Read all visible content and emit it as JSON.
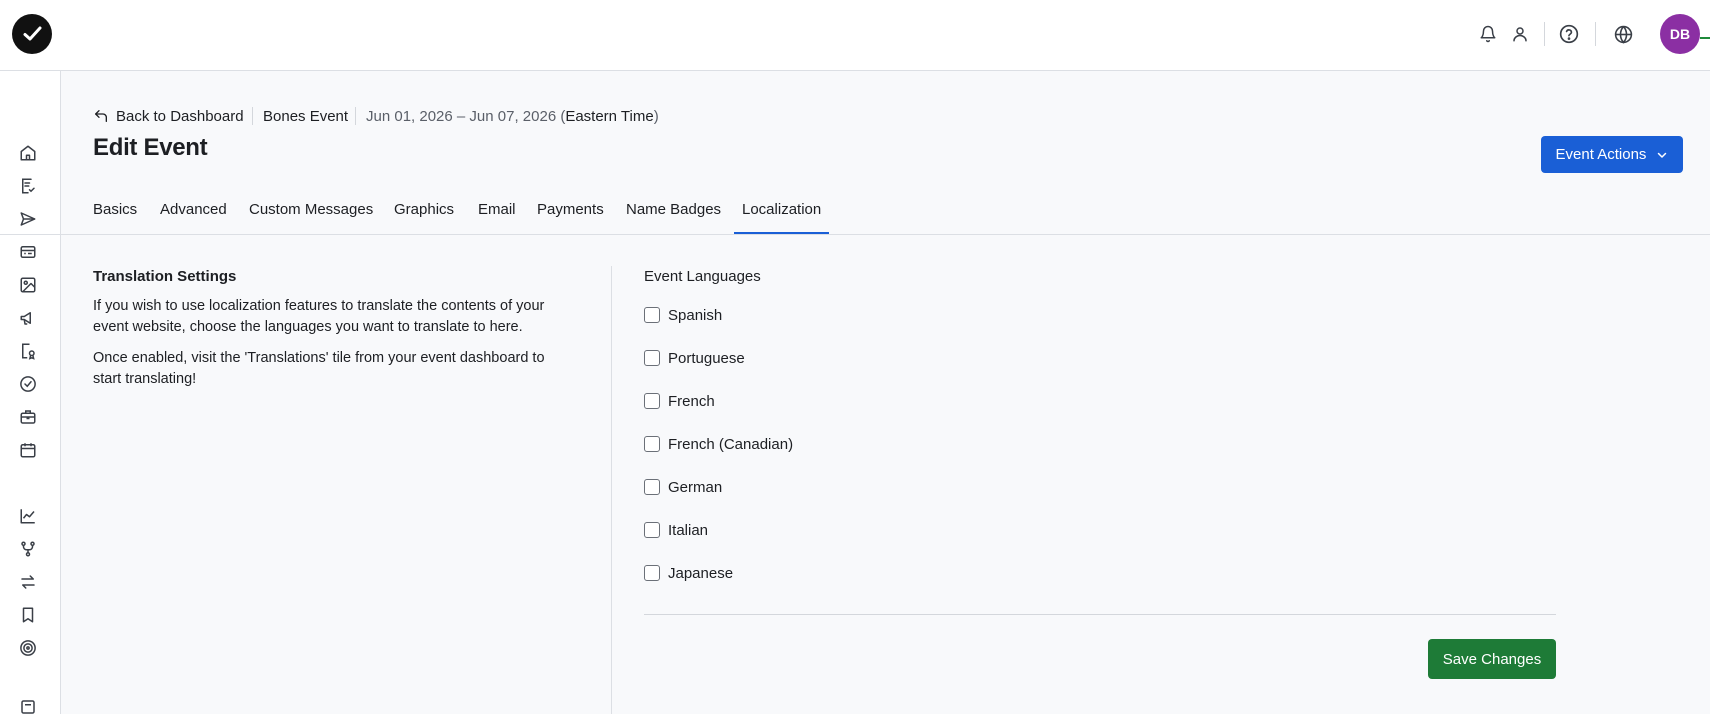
{
  "header": {
    "logo_icon": "check-circle-logo",
    "icons": [
      "bell-icon",
      "user-icon",
      "help-icon",
      "globe-icon"
    ],
    "avatar_initials": "DB",
    "avatar_color": "#8b2fa3"
  },
  "sidebar": {
    "icons": [
      "home-icon",
      "checklist-icon",
      "send-icon",
      "registration-icon",
      "image-icon",
      "megaphone-icon",
      "badge-search-icon",
      "check-circle-icon",
      "briefcase-icon",
      "calendar-icon",
      "chart-line-icon",
      "branch-icon",
      "swap-icon",
      "bookmark-icon",
      "target-icon"
    ]
  },
  "breadcrumb": {
    "back_label": "Back to Dashboard",
    "event_name": "Bones Event",
    "dates": "Jun 01, 2026 – Jun 07, 2026 (",
    "timezone": "Eastern Time",
    "dates_close": ")"
  },
  "page": {
    "title": "Edit Event",
    "actions_label": "Event Actions"
  },
  "tabs": [
    {
      "label": "Basics"
    },
    {
      "label": "Advanced"
    },
    {
      "label": "Custom Messages"
    },
    {
      "label": "Graphics"
    },
    {
      "label": "Email"
    },
    {
      "label": "Payments"
    },
    {
      "label": "Name Badges"
    },
    {
      "label": "Localization",
      "active": true
    }
  ],
  "translation": {
    "title": "Translation Settings",
    "paragraph1": "If you wish to use localization features to translate the contents of your event website, choose the languages you want to translate to here.",
    "paragraph2": "Once enabled, visit the 'Translations' tile from your event dashboard to start translating!"
  },
  "languages": {
    "title": "Event Languages",
    "items": [
      {
        "label": "Spanish",
        "checked": false
      },
      {
        "label": "Portuguese",
        "checked": false
      },
      {
        "label": "French",
        "checked": false
      },
      {
        "label": "French (Canadian)",
        "checked": false
      },
      {
        "label": "German",
        "checked": false
      },
      {
        "label": "Italian",
        "checked": false
      },
      {
        "label": "Japanese",
        "checked": false
      }
    ]
  },
  "save_label": "Save Changes",
  "colors": {
    "primary": "#1a5fd6",
    "save": "#1e7b37"
  }
}
